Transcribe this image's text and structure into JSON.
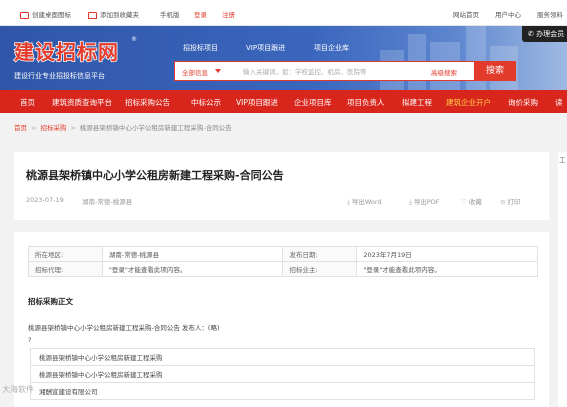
{
  "topbar": {
    "create_shortcut": "创建桌面图标",
    "add_favorite": "添加到收藏夹",
    "mobile": "手机版",
    "login": "登录",
    "register": "注册",
    "site_home": "网站首页",
    "user_center": "用户中心",
    "service": "服务领料"
  },
  "header": {
    "logo": "建设招标网",
    "logo_reg": "®",
    "slogan": "建设行业专业招投标信息平台",
    "nav": [
      "招投标项目",
      "VIP项目跟进",
      "项目企业库"
    ],
    "search_category": "全部信息",
    "search_placeholder": "输入关键词，如：学校监控、机房、医院等",
    "advanced_search": "高级搜索",
    "search_button": "搜索",
    "phone_badge": "办理会员"
  },
  "mainnav": [
    "首页",
    "建筑资质查询平台",
    "招标采购公告",
    "中标公示",
    "VIP项目跟进",
    "企业项目库",
    "项目负责人",
    "拟建工程",
    "建筑企业开户",
    "询价采购",
    "读"
  ],
  "breadcrumb": {
    "home": "首页",
    "category": "招标采购",
    "current": "桃源县架桥镇中心小学公租房新建工程采购-合同公告"
  },
  "article": {
    "title": "桃源县架桥镇中心小学公租房新建工程采购-合同公告",
    "date": "2023-07-19",
    "region": "湖南-常德-桃源县",
    "actions": {
      "export_word": "导出Word",
      "export_pdf": "导出PDF",
      "favorite": "收藏",
      "print": "打印"
    }
  },
  "info_table": {
    "rows": [
      {
        "k1": "所在地区:",
        "v1": "湖南-常德-桃源县",
        "k2": "发布日期:",
        "v2": "2023年7月19日"
      },
      {
        "k1": "招标代理:",
        "v1": "\"登录\"才能查看此项内容。",
        "k2": "招标业主:",
        "v2": "\"登录\"才能查看此项内容。"
      }
    ]
  },
  "body": {
    "section_title": "招标采购正文",
    "line1": "桃源县架桥镇中心小学公租房新建工程采购-合同公告 发布人：(略)",
    "line2": "?",
    "items": [
      "桃源县架桥镇中心小学公租房新建工程采购",
      "桃源县架桥镇中心小学公租房新建工程采购",
      "湘酬宣建设有限公司"
    ]
  },
  "right_strip": {
    "label": "工"
  },
  "watermark": "大海软件"
}
